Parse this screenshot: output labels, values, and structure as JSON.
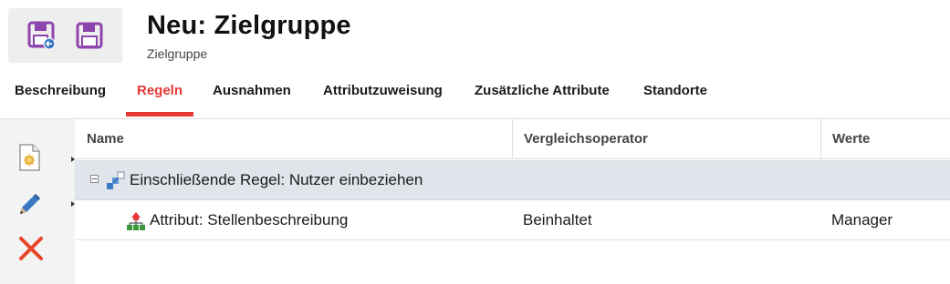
{
  "header": {
    "title": "Neu: Zielgruppe",
    "subtitle": "Zielgruppe"
  },
  "toolbar": {
    "buttons": [
      {
        "icon": "save-and-return-icon"
      },
      {
        "icon": "save-icon"
      }
    ]
  },
  "tabs": [
    {
      "label": "Beschreibung",
      "active": false
    },
    {
      "label": "Regeln",
      "active": true
    },
    {
      "label": "Ausnahmen",
      "active": false
    },
    {
      "label": "Attributzuweisung",
      "active": false
    },
    {
      "label": "Zusätzliche Attribute",
      "active": false
    },
    {
      "label": "Standorte",
      "active": false
    }
  ],
  "side_actions": [
    {
      "icon": "new-document-icon",
      "has_menu": true
    },
    {
      "icon": "edit-pencil-icon",
      "has_menu": true
    },
    {
      "icon": "delete-x-icon",
      "has_menu": false
    }
  ],
  "grid": {
    "columns": [
      "Name",
      "Vergleichsoperator",
      "Werte"
    ],
    "group": {
      "label": "Einschließende Regel: Nutzer einbeziehen",
      "expanded": true
    },
    "rows": [
      {
        "name": "Attribut: Stellenbeschreibung",
        "operator": "Beinhaltet",
        "value": "Manager"
      }
    ]
  },
  "colors": {
    "accent": "#e53935",
    "group_row_bg": "#dfe5ea",
    "save_icon": "#8e44ad"
  }
}
